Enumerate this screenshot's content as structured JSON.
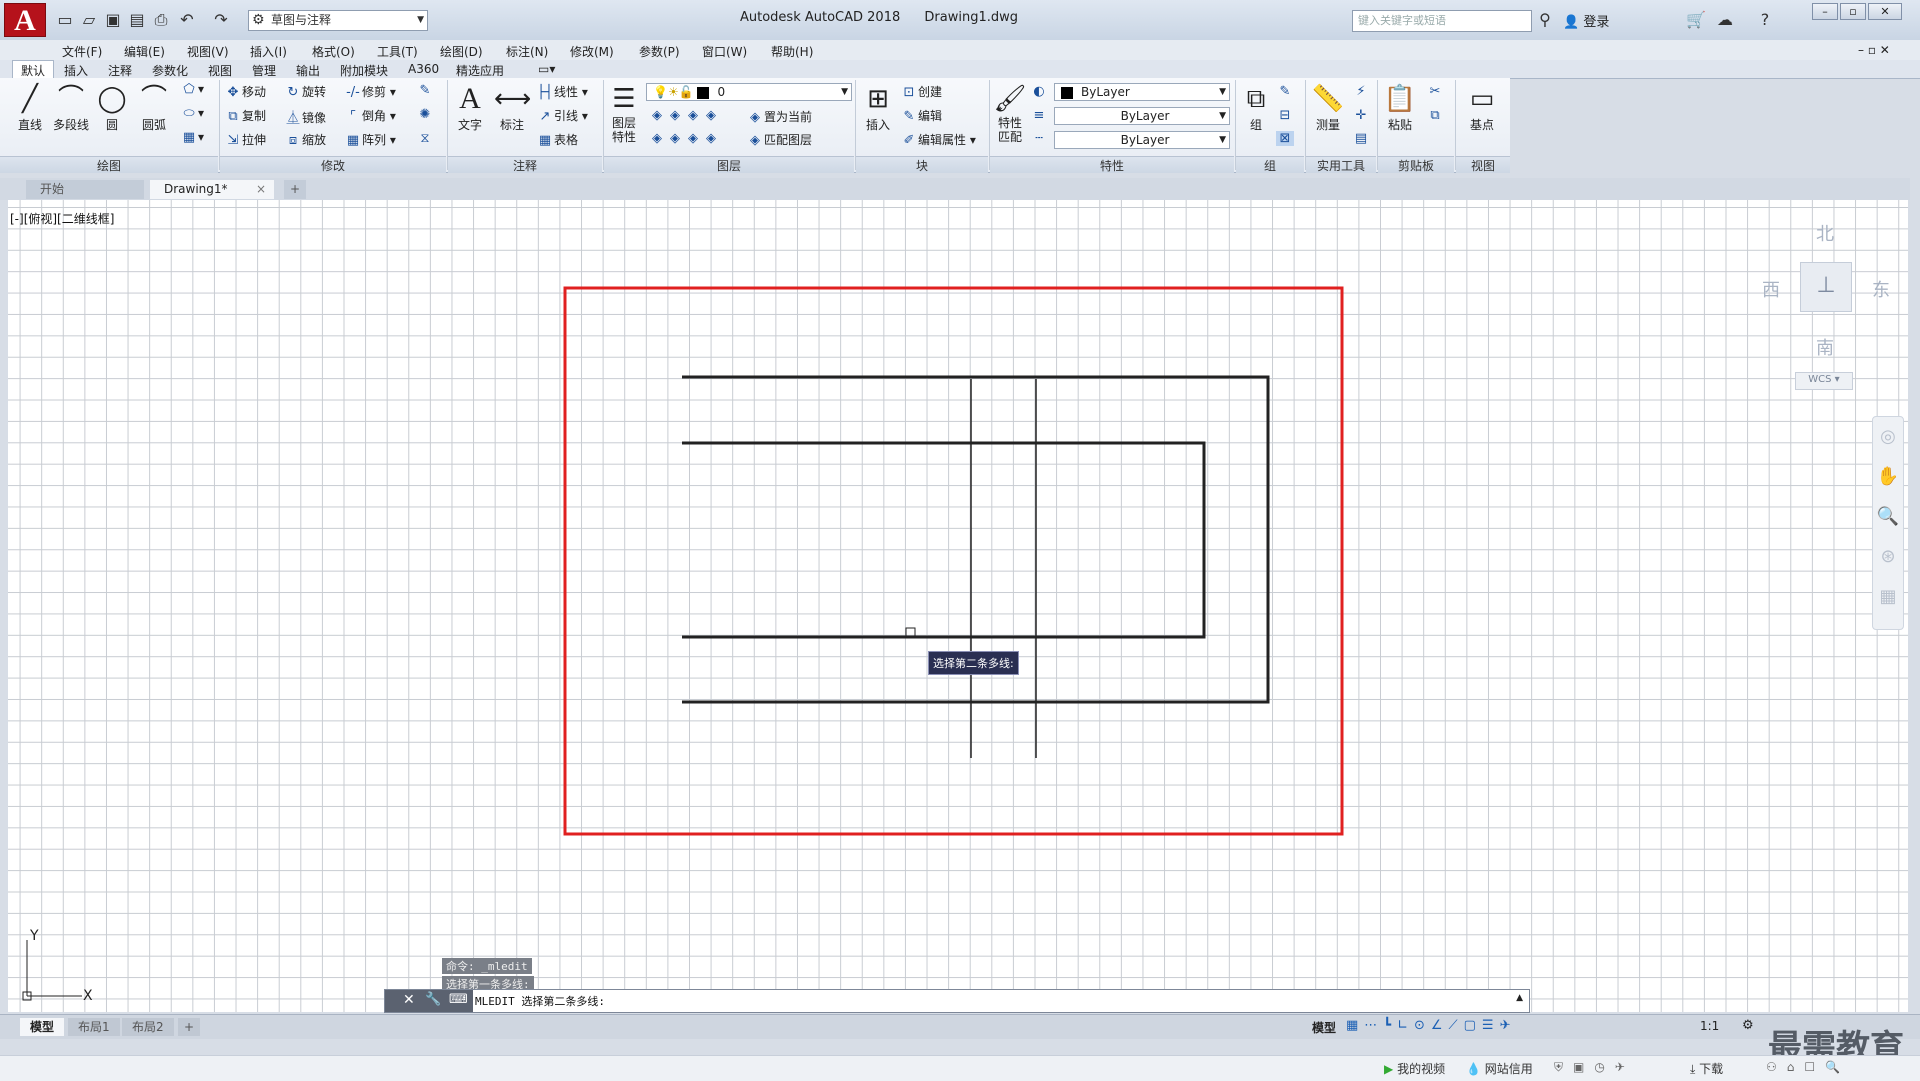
{
  "window": {
    "title": "Autodesk AutoCAD 2018",
    "filename": "Drawing1.dwg",
    "workspace": "草图与注释",
    "search_placeholder": "键入关键字或短语",
    "login_label": "登录"
  },
  "menu": [
    "文件(F)",
    "编辑(E)",
    "视图(V)",
    "插入(I)",
    "格式(O)",
    "工具(T)",
    "绘图(D)",
    "标注(N)",
    "修改(M)",
    "参数(P)",
    "窗口(W)",
    "帮助(H)"
  ],
  "ribbon_tabs": [
    "默认",
    "插入",
    "注释",
    "参数化",
    "视图",
    "管理",
    "输出",
    "附加模块",
    "A360",
    "精选应用"
  ],
  "ribbon": {
    "draw": {
      "line": "直线",
      "polyline": "多段线",
      "circle": "圆",
      "arc": "圆弧",
      "label": "绘图"
    },
    "modify": {
      "move": "移动",
      "rotate": "旋转",
      "trim": "修剪",
      "copy": "复制",
      "mirror": "镜像",
      "fillet": "倒角",
      "stretch": "拉伸",
      "scale": "缩放",
      "array": "阵列",
      "label": "修改"
    },
    "annotation": {
      "text": "文字",
      "dimension": "标注",
      "linear": "线性",
      "leader": "引线",
      "table": "表格",
      "label": "注释"
    },
    "layers": {
      "properties": "图层\n特性",
      "current_layer": "0",
      "make_current": "置为当前",
      "match_layer": "匹配图层",
      "label": "图层"
    },
    "block": {
      "insert": "插入",
      "create": "创建",
      "edit": "编辑",
      "edit_attributes": "编辑属性",
      "label": "块"
    },
    "properties": {
      "match": "特性\n匹配",
      "color": "ByLayer",
      "linetype": "ByLayer",
      "lineweight": "ByLayer",
      "label": "特性"
    },
    "groups": {
      "group": "组",
      "label": "组"
    },
    "utilities": {
      "measure": "测量",
      "label": "实用工具"
    },
    "clipboard": {
      "paste": "粘贴",
      "label": "剪贴板"
    },
    "view": {
      "base": "基点",
      "label": "视图"
    }
  },
  "file_tabs": [
    "开始",
    "Drawing1*"
  ],
  "viewport_label": "[-][俯视][二维线框]",
  "viewcube": {
    "north": "北",
    "south": "南",
    "east": "东",
    "west": "西",
    "wcs": "WCS"
  },
  "tooltip": "选择第二条多线:",
  "command_history": [
    "命令: _mledit",
    "选择第一条多线:"
  ],
  "command_line": "MLEDIT 选择第二条多线:",
  "layout_tabs": [
    "模型",
    "布局1",
    "布局2"
  ],
  "status": {
    "model": "模型",
    "scale": "1:1"
  },
  "taskbar": [
    "我的视频",
    "网站信用",
    "下载"
  ],
  "watermark": "最需教育"
}
